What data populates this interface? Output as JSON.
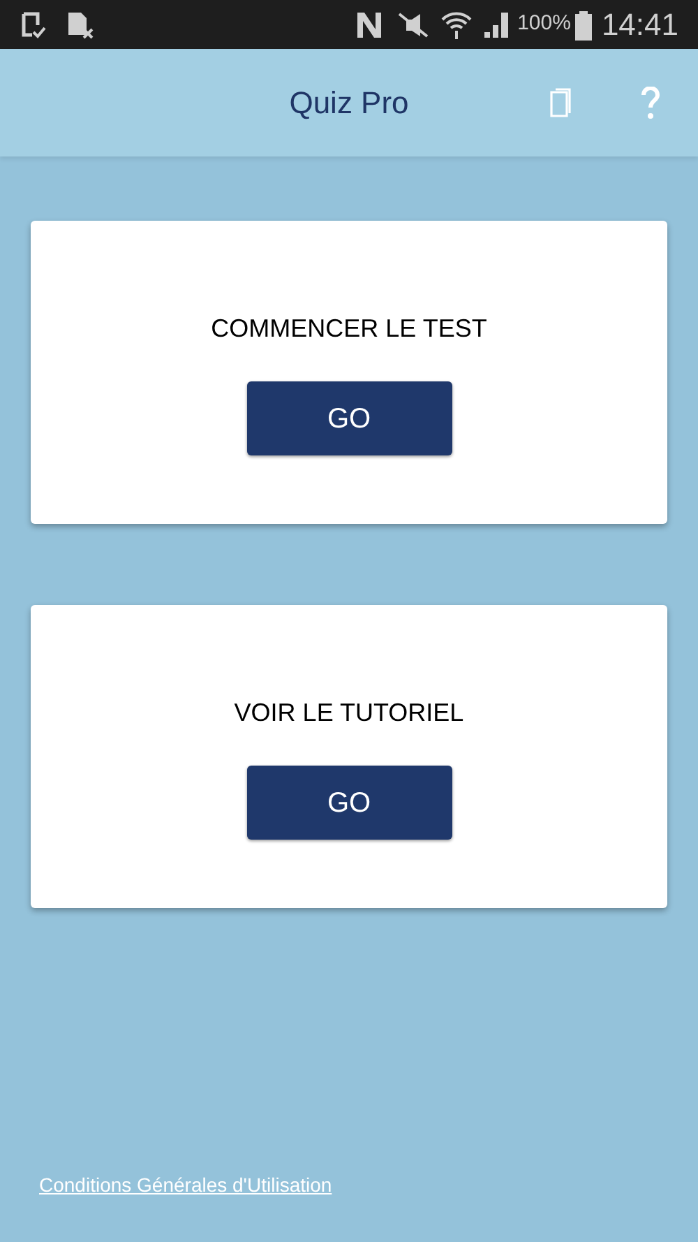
{
  "status_bar": {
    "battery": "100%",
    "time": "14:41"
  },
  "app_bar": {
    "title": "Quiz Pro"
  },
  "cards": [
    {
      "title": "COMMENCER LE TEST",
      "button": "GO"
    },
    {
      "title": "VOIR LE TUTORIEL",
      "button": "GO"
    }
  ],
  "footer_link": "Conditions Générales d'Utilisation"
}
